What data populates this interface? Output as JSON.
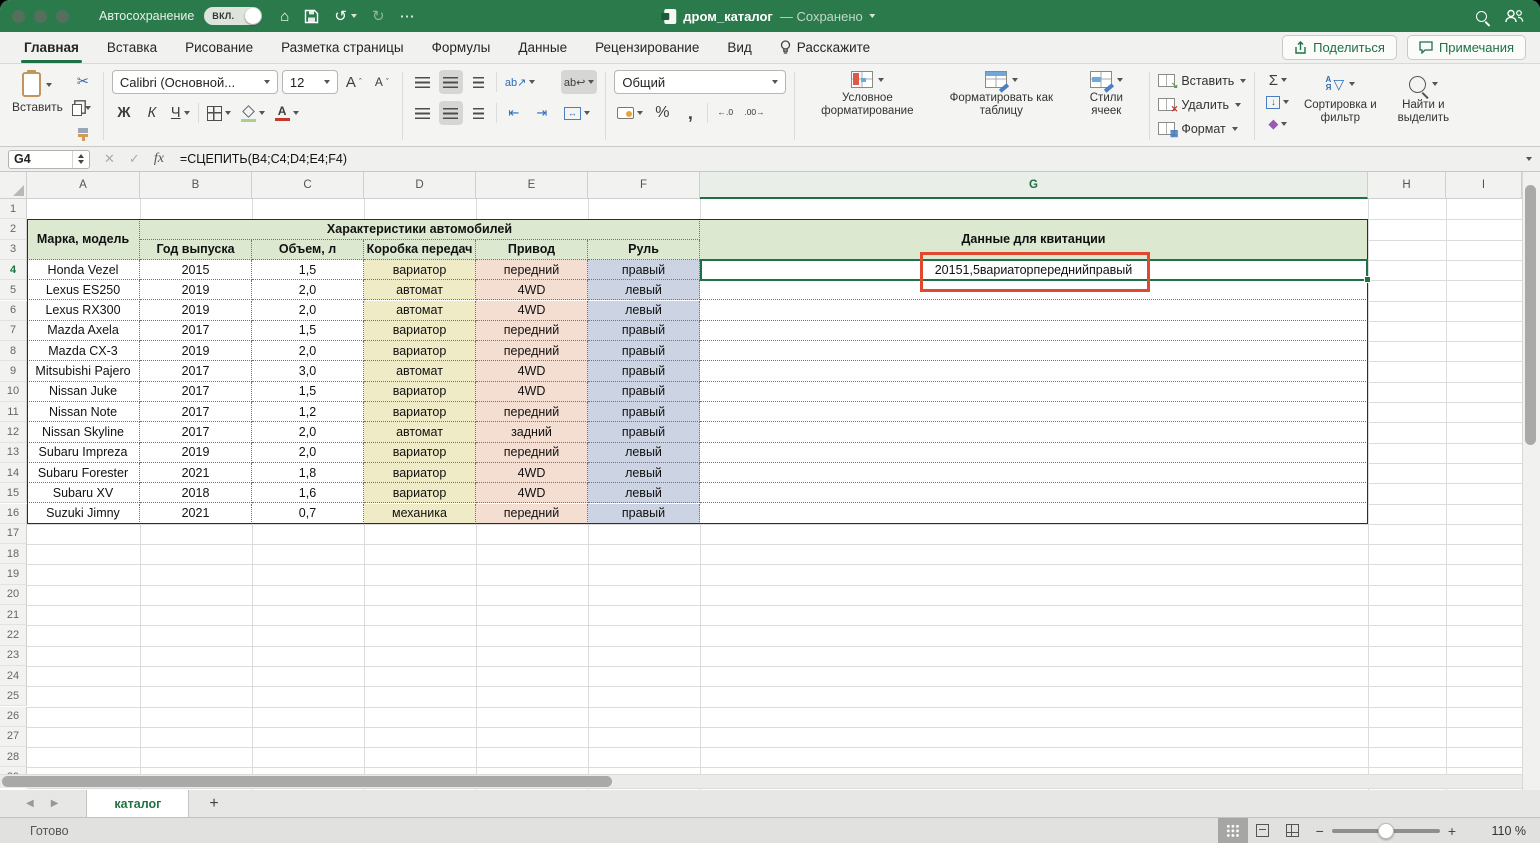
{
  "colors": {
    "titlebar": "#2b7a4c",
    "accent_green": "#1e7145",
    "header_bg": "#dce8d0",
    "gearbox_bg": "#f0ebc7",
    "drive_bg": "#f4ded2",
    "wheel_bg": "#ccd4e3",
    "selection": "#1f7245",
    "annotation": "#e0492e"
  },
  "icons": {
    "home": "⌂",
    "undo": "↺",
    "redo": "↻",
    "more": "⋯",
    "scissors": "✂",
    "font_letter": "А",
    "grow": "ˆ",
    "shrink": "ˇ",
    "orientation": "ab↗",
    "wrap": "ab↩",
    "merge": "↔",
    "indent_left": "⇤",
    "indent_right": "⇥",
    "percent": "%",
    "comma": ",",
    "dec_left": "←.0",
    "dec_right": ".00→",
    "sum": "Σ",
    "fill_down": "↓",
    "eraser": "◆",
    "sort_a": "А",
    "sort_z": "Я",
    "funnel": "▽",
    "left_arrow": "◀",
    "right_arrow": "▶",
    "plus": "+",
    "minus": "−",
    "x_mark": "✕",
    "check_mark": "✓",
    "fx": "fx",
    "insert_mark": "↘",
    "delete_mark": "✕",
    "format_mark": "▦"
  },
  "titlebar": {
    "autosave_label": "Автосохранение",
    "autosave_state": "ВКЛ.",
    "filename": "дром_каталог",
    "save_status": "— Сохранено"
  },
  "tab_bar": {
    "tabs": [
      "Главная",
      "Вставка",
      "Рисование",
      "Разметка страницы",
      "Формулы",
      "Данные",
      "Рецензирование",
      "Вид",
      "Расскажите"
    ],
    "share_button": "Поделиться",
    "comments_button": "Примечания"
  },
  "ribbon": {
    "paste": "Вставить",
    "font_name": "Calibri (Основной...",
    "font_size": "12",
    "bold": "Ж",
    "italic": "К",
    "underline": "Ч",
    "number_format": "Общий",
    "conditional_formatting": "Условное форматирование",
    "format_as_table": "Форматировать как таблицу",
    "cell_styles": "Стили ячеек",
    "insert": "Вставить",
    "delete": "Удалить",
    "format": "Формат",
    "sort_filter": "Сортировка и фильтр",
    "find_select": "Найти и выделить"
  },
  "formula_bar": {
    "cell_ref": "G4",
    "formula": "=СЦЕПИТЬ(B4;C4;D4;E4;F4)"
  },
  "grid": {
    "column_letters": [
      "A",
      "B",
      "C",
      "D",
      "E",
      "F",
      "G",
      "H",
      "I"
    ],
    "visible_rows": 29,
    "selected_cell": "G4",
    "selected_column": "G",
    "selected_row": 4,
    "table": {
      "corner_header": "Марка, модель",
      "group_header": "Характеристики автомобилей",
      "receipt_header": "Данные для квитанции",
      "sub_headers": [
        "Год выпуска",
        "Объем, л",
        "Коробка передач",
        "Привод",
        "Руль"
      ],
      "rows": [
        {
          "model": "Honda Vezel",
          "year": "2015",
          "volume": "1,5",
          "gearbox": "вариатор",
          "drive": "передний",
          "wheel": "правый"
        },
        {
          "model": "Lexus ES250",
          "year": "2019",
          "volume": "2,0",
          "gearbox": "автомат",
          "drive": "4WD",
          "wheel": "левый"
        },
        {
          "model": "Lexus RX300",
          "year": "2019",
          "volume": "2,0",
          "gearbox": "автомат",
          "drive": "4WD",
          "wheel": "левый"
        },
        {
          "model": "Mazda Axela",
          "year": "2017",
          "volume": "1,5",
          "gearbox": "вариатор",
          "drive": "передний",
          "wheel": "правый"
        },
        {
          "model": "Mazda CX-3",
          "year": "2019",
          "volume": "2,0",
          "gearbox": "вариатор",
          "drive": "передний",
          "wheel": "правый"
        },
        {
          "model": "Mitsubishi Pajero",
          "year": "2017",
          "volume": "3,0",
          "gearbox": "автомат",
          "drive": "4WD",
          "wheel": "правый"
        },
        {
          "model": "Nissan Juke",
          "year": "2017",
          "volume": "1,5",
          "gearbox": "вариатор",
          "drive": "4WD",
          "wheel": "правый"
        },
        {
          "model": "Nissan Note",
          "year": "2017",
          "volume": "1,2",
          "gearbox": "вариатор",
          "drive": "передний",
          "wheel": "правый"
        },
        {
          "model": "Nissan Skyline",
          "year": "2017",
          "volume": "2,0",
          "gearbox": "автомат",
          "drive": "задний",
          "wheel": "правый"
        },
        {
          "model": "Subaru Impreza",
          "year": "2019",
          "volume": "2,0",
          "gearbox": "вариатор",
          "drive": "передний",
          "wheel": "левый"
        },
        {
          "model": "Subaru Forester",
          "year": "2021",
          "volume": "1,8",
          "gearbox": "вариатор",
          "drive": "4WD",
          "wheel": "левый"
        },
        {
          "model": "Subaru XV",
          "year": "2018",
          "volume": "1,6",
          "gearbox": "вариатор",
          "drive": "4WD",
          "wheel": "левый"
        },
        {
          "model": "Suzuki Jimny",
          "year": "2021",
          "volume": "0,7",
          "gearbox": "механика",
          "drive": "передний",
          "wheel": "правый"
        }
      ],
      "g4_value": "20151,5вариаторпереднийправый"
    }
  },
  "sheet_bar": {
    "active_sheet": "каталог"
  },
  "status_bar": {
    "ready": "Готово",
    "zoom_level": "110 %"
  }
}
